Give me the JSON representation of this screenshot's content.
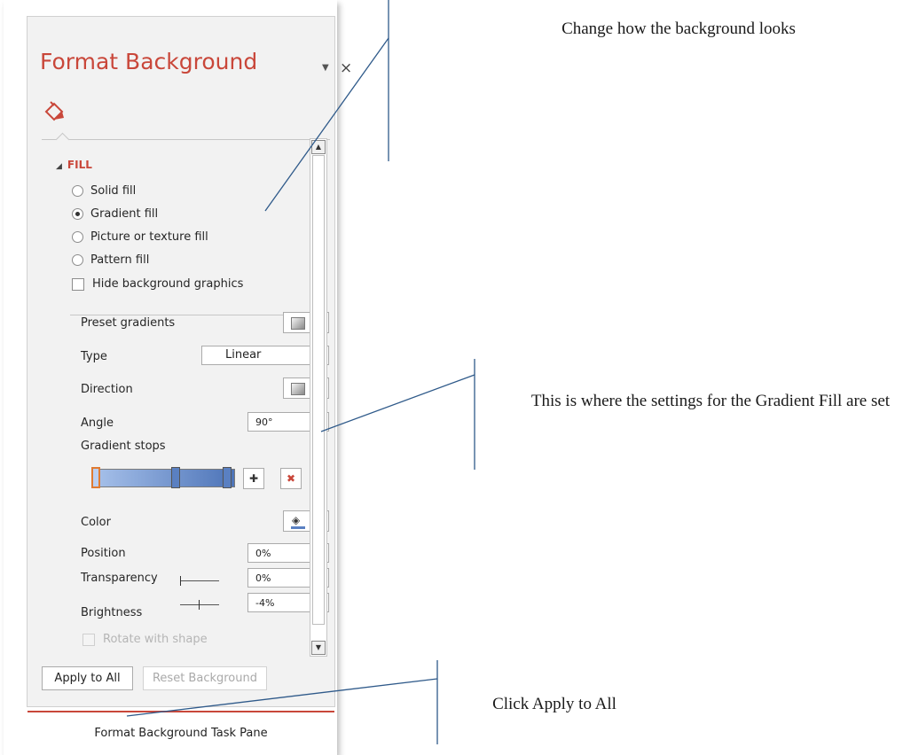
{
  "pane": {
    "title": "Format Background",
    "pin_icon": "dropdown-caret-icon",
    "close_label": "×",
    "fill_tab_icon": "paint-bucket-icon",
    "section_label": "FILL",
    "fill_options": {
      "solid": "Solid fill",
      "gradient": "Gradient fill",
      "picture": "Picture or texture fill",
      "pattern": "Pattern fill",
      "selected": "Gradient fill"
    },
    "hide_graphics": "Hide background graphics",
    "preset_gradients": "Preset gradients",
    "type_label": "Type",
    "type_value": "Linear",
    "direction_label": "Direction",
    "angle_label": "Angle",
    "angle_value": "90°",
    "gradient_stops_label": "Gradient stops",
    "color_label": "Color",
    "position_label": "Position",
    "position_value": "0%",
    "transparency_label": "Transparency",
    "transparency_value": "0%",
    "brightness_label": "Brightness",
    "brightness_value": "-4%",
    "rotate_label": "Rotate with shape",
    "apply_all": "Apply to All",
    "reset_background": "Reset Background",
    "caption": "Format Background Task Pane",
    "accent_color": "#c9473a"
  },
  "annotations": {
    "top": "Change how the background looks",
    "middle": "This is where the settings for the Gradient Fill are set",
    "bottom": "Click Apply to All",
    "line_color": "#2f5a8a"
  }
}
